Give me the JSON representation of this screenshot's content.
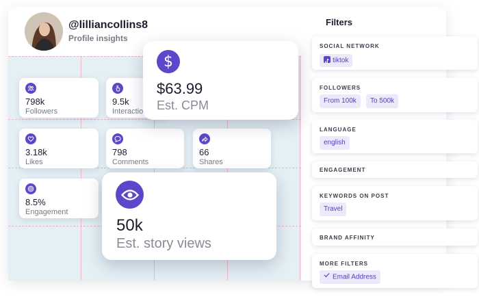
{
  "profile": {
    "handle": "@lilliancollins8",
    "subtitle": "Profile insights"
  },
  "stats": {
    "followers": {
      "value": "798k",
      "label": "Followers",
      "icon": "users-icon"
    },
    "interactions": {
      "value": "9.5k",
      "label": "Interactions",
      "icon": "hand-pointer-icon"
    },
    "likes": {
      "value": "3.18k",
      "label": "Likes",
      "icon": "heart-icon"
    },
    "comments": {
      "value": "798",
      "label": "Comments",
      "icon": "comment-icon"
    },
    "shares": {
      "value": "66",
      "label": "Shares",
      "icon": "share-icon"
    },
    "engagement": {
      "value": "8.5%",
      "label": "Engagement",
      "icon": "target-icon"
    }
  },
  "cpm": {
    "value": "$63.99",
    "label": "Est. CPM",
    "icon": "dollar-icon"
  },
  "story_views": {
    "value": "50k",
    "label": "Est. story views",
    "icon": "eye-icon"
  },
  "filters": {
    "title": "Filters",
    "social_network": {
      "title": "SOCIAL NETWORK",
      "chip": "tiktok"
    },
    "followers": {
      "title": "FOLLOWERS",
      "from": "From 100k",
      "to": "To 500k"
    },
    "language": {
      "title": "LANGUAGE",
      "chip": "english"
    },
    "engagement": {
      "title": "ENGAGEMENT"
    },
    "keywords": {
      "title": "KEYWORDS ON POST",
      "chip": "Travel"
    },
    "brand_affinity": {
      "title": "BRAND AFFINITY"
    },
    "more_filters": {
      "title": "MORE FILTERS",
      "chip": "Email Address"
    }
  },
  "colors": {
    "accent": "#5b47c9",
    "chip_bg": "#ede9fb",
    "grid_bg": "#e4f0f4"
  }
}
